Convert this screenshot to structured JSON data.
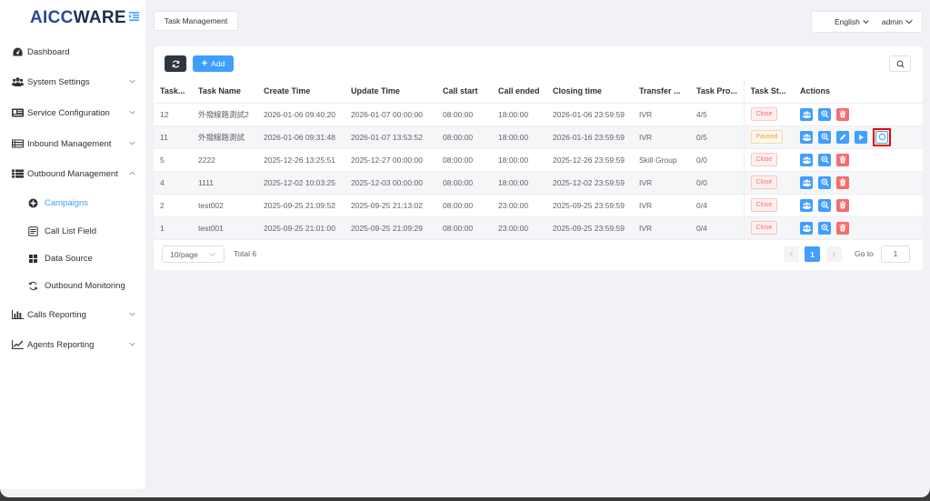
{
  "brand": {
    "logo_part1": "AICC",
    "logo_part2": "WARE"
  },
  "sidebar": {
    "items": [
      {
        "label": "Dashboard",
        "icon": "dashboard-icon"
      },
      {
        "label": "System Settings",
        "icon": "users-icon"
      },
      {
        "label": "Service Configuration",
        "icon": "id-card-icon"
      },
      {
        "label": "Inbound Management",
        "icon": "list-icon"
      },
      {
        "label": "Outbound Management",
        "icon": "list-icon"
      },
      {
        "label": "Calls Reporting",
        "icon": "bar-chart-icon"
      },
      {
        "label": "Agents Reporting",
        "icon": "line-chart-icon"
      }
    ],
    "sub_items": [
      {
        "label": "Campaigns",
        "icon": "campaign-icon"
      },
      {
        "label": "Call List Field",
        "icon": "form-icon"
      },
      {
        "label": "Data Source",
        "icon": "grid-icon"
      },
      {
        "label": "Outbound Monitoring",
        "icon": "refresh-icon"
      }
    ]
  },
  "header": {
    "tab": "Task Management",
    "language": "English",
    "user": "admin"
  },
  "toolbar": {
    "add_label": "Add"
  },
  "table": {
    "columns": [
      "Task...",
      "Task Name",
      "Create Time",
      "Update Time",
      "Call start",
      "Call ended",
      "Closing time",
      "Transfer ...",
      "Task Pro...",
      "Task St...",
      "Actions"
    ],
    "rows": [
      {
        "id": "12",
        "name": "外撥線路測試2",
        "create": "2026-01-06 09:40:20",
        "update": "2026-01-07 00:00:00",
        "start": "08:00:00",
        "end": "18:00:00",
        "closing": "2026-01-06 23:59:59",
        "transfer": "IVR",
        "progress": "4/5",
        "status": "Close"
      },
      {
        "id": "11",
        "name": "外撥線路測試",
        "create": "2026-01-06 09:31:48",
        "update": "2026-01-07 13:53:52",
        "start": "08:00:00",
        "end": "18:00:00",
        "closing": "2026-01-16 23:59:59",
        "transfer": "IVR",
        "progress": "0/5",
        "status": "Paused"
      },
      {
        "id": "5",
        "name": "2222",
        "create": "2025-12-26 13:25:51",
        "update": "2025-12-27 00:00:00",
        "start": "08:00:00",
        "end": "18:00:00",
        "closing": "2025-12-26 23:59:59",
        "transfer": "Skill Group",
        "progress": "0/0",
        "status": "Close"
      },
      {
        "id": "4",
        "name": "1111",
        "create": "2025-12-02 10:03:25",
        "update": "2025-12-03 00:00:00",
        "start": "08:00:00",
        "end": "18:00:00",
        "closing": "2025-12-02 23:59:59",
        "transfer": "IVR",
        "progress": "0/0",
        "status": "Close"
      },
      {
        "id": "2",
        "name": "test002",
        "create": "2025-09-25 21:09:52",
        "update": "2025-09-25 21:13:02",
        "start": "08:00:00",
        "end": "23:00:00",
        "closing": "2025-09-25 23:59:59",
        "transfer": "IVR",
        "progress": "0/4",
        "status": "Close"
      },
      {
        "id": "1",
        "name": "test001",
        "create": "2025-09-25 21:01:00",
        "update": "2025-09-25 21:09:29",
        "start": "08:00:00",
        "end": "23:00:00",
        "closing": "2025-09-25 23:59:59",
        "transfer": "IVR",
        "progress": "0/4",
        "status": "Close"
      }
    ]
  },
  "pagination": {
    "page_size": "10/page",
    "total": "Total 6",
    "current": "1",
    "goto_label": "Go to",
    "goto_value": "1"
  },
  "colors": {
    "primary": "#409eff",
    "danger": "#f56c6c",
    "warning": "#e6a23c",
    "dark": "#2f3640"
  }
}
